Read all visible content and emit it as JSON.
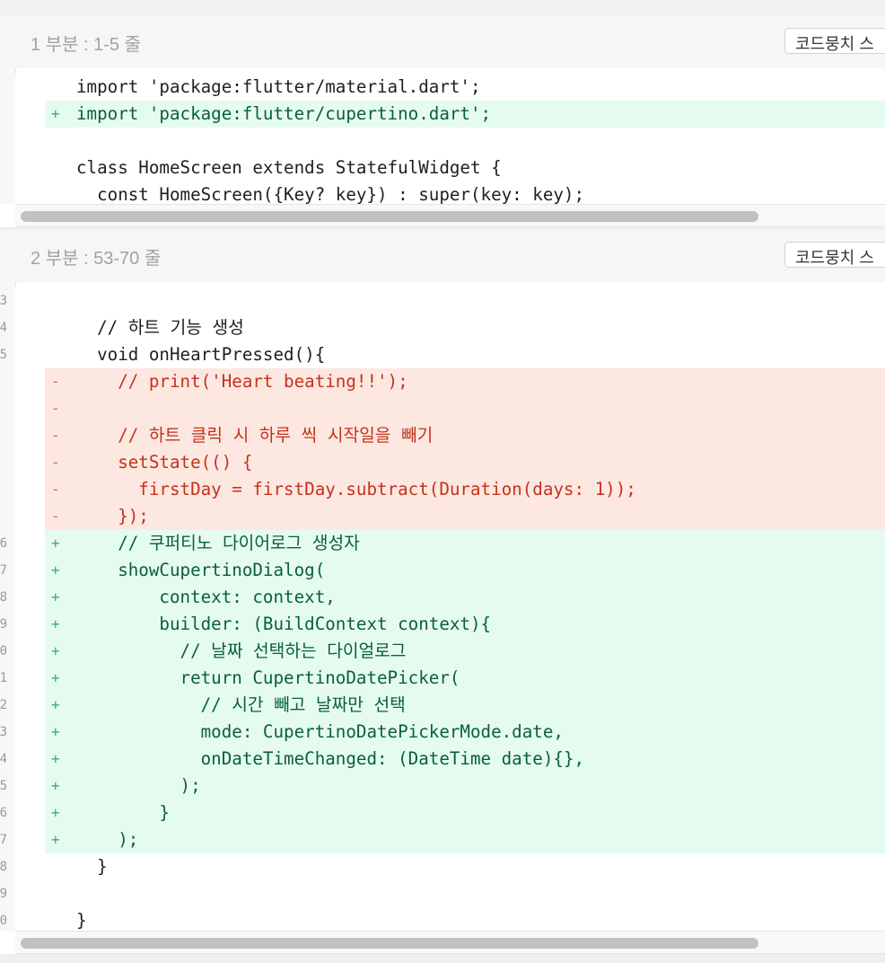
{
  "sections": [
    {
      "title": "1 부분 : 1-5 줄",
      "button_label": "코드뭉치 스",
      "lines": [
        {
          "type": "ctx",
          "marker": "",
          "num": "",
          "code": "import 'package:flutter/material.dart';"
        },
        {
          "type": "add",
          "marker": "+",
          "num": "",
          "code": "import 'package:flutter/cupertino.dart';"
        },
        {
          "type": "ctx",
          "marker": "",
          "num": "",
          "code": ""
        },
        {
          "type": "ctx",
          "marker": "",
          "num": "",
          "code": "class HomeScreen extends StatefulWidget {"
        },
        {
          "type": "ctx",
          "marker": "",
          "num": "",
          "code": "  const HomeScreen({Key? key}) : super(key: key);"
        }
      ]
    },
    {
      "title": "2 부분 : 53-70 줄",
      "button_label": "코드뭉치 스",
      "lines": [
        {
          "type": "ctx",
          "marker": "",
          "num": "3",
          "code": ""
        },
        {
          "type": "ctx",
          "marker": "",
          "num": "4",
          "code": "  // 하트 기능 생성"
        },
        {
          "type": "ctx",
          "marker": "",
          "num": "5",
          "code": "  void onHeartPressed(){"
        },
        {
          "type": "del",
          "marker": "-",
          "num": "",
          "code": "    // print('Heart beating!!');"
        },
        {
          "type": "del",
          "marker": "-",
          "num": "",
          "code": ""
        },
        {
          "type": "del",
          "marker": "-",
          "num": "",
          "code": "    // 하트 클릭 시 하루 씩 시작일을 빼기"
        },
        {
          "type": "del",
          "marker": "-",
          "num": "",
          "code": "    setState(() {"
        },
        {
          "type": "del",
          "marker": "-",
          "num": "",
          "code": "      firstDay = firstDay.subtract(Duration(days: 1));"
        },
        {
          "type": "del",
          "marker": "-",
          "num": "",
          "code": "    });"
        },
        {
          "type": "add",
          "marker": "+",
          "num": "6",
          "code": "    // 쿠퍼티노 다이어로그 생성자"
        },
        {
          "type": "add",
          "marker": "+",
          "num": "7",
          "code": "    showCupertinoDialog("
        },
        {
          "type": "add",
          "marker": "+",
          "num": "8",
          "code": "        context: context,"
        },
        {
          "type": "add",
          "marker": "+",
          "num": "9",
          "code": "        builder: (BuildContext context){"
        },
        {
          "type": "add",
          "marker": "+",
          "num": "0",
          "code": "          // 날짜 선택하는 다이얼로그"
        },
        {
          "type": "add",
          "marker": "+",
          "num": "1",
          "code": "          return CupertinoDatePicker("
        },
        {
          "type": "add",
          "marker": "+",
          "num": "2",
          "code": "            // 시간 빼고 날짜만 선택"
        },
        {
          "type": "add",
          "marker": "+",
          "num": "3",
          "code": "            mode: CupertinoDatePickerMode.date,"
        },
        {
          "type": "add",
          "marker": "+",
          "num": "4",
          "code": "            onDateTimeChanged: (DateTime date){},"
        },
        {
          "type": "add",
          "marker": "+",
          "num": "5",
          "code": "          );"
        },
        {
          "type": "add",
          "marker": "+",
          "num": "6",
          "code": "        }"
        },
        {
          "type": "add",
          "marker": "+",
          "num": "7",
          "code": "    );"
        },
        {
          "type": "ctx",
          "marker": "",
          "num": "8",
          "code": "  }"
        },
        {
          "type": "ctx",
          "marker": "",
          "num": "9",
          "code": ""
        },
        {
          "type": "ctx",
          "marker": "",
          "num": "0",
          "code": "}"
        }
      ]
    }
  ],
  "colors": {
    "added_bg": "#e5fbef",
    "added_text": "#0a5f39",
    "removed_bg": "#fde7e1",
    "removed_text": "#c3331b"
  }
}
